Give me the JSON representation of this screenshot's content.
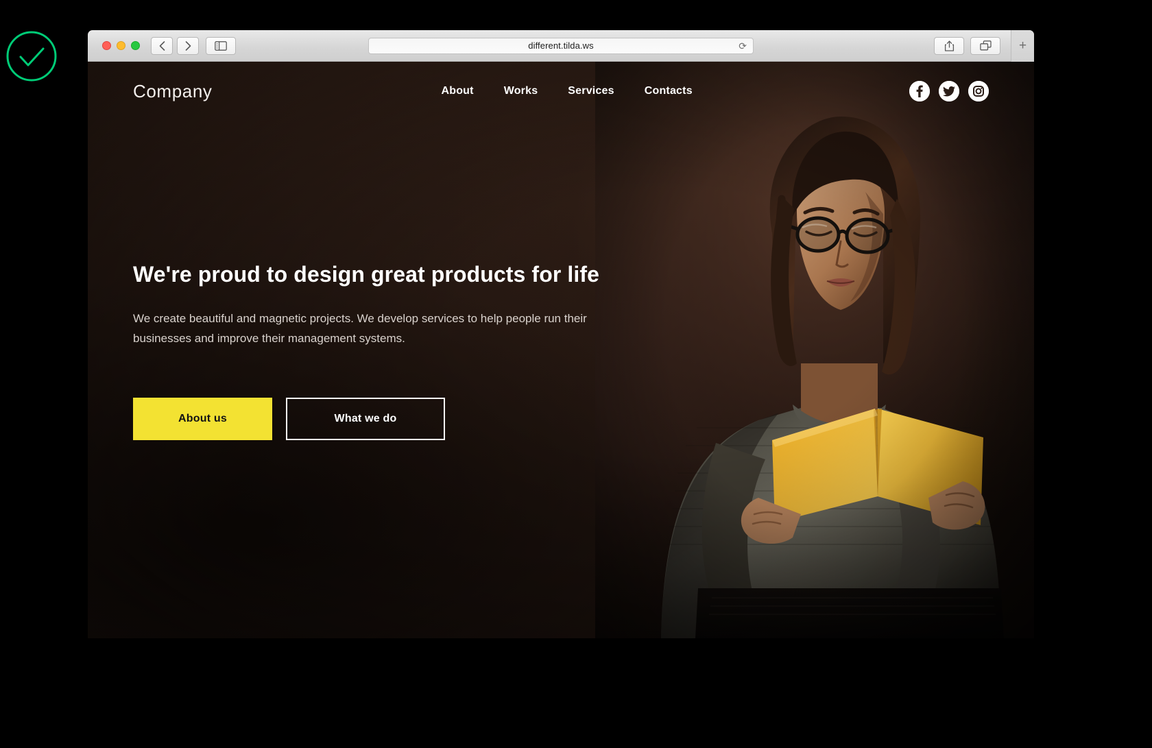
{
  "badge": {
    "name": "success-check",
    "color": "#00cc77"
  },
  "browser": {
    "url": "different.tilda.ws",
    "traffic_lights": [
      "close",
      "minimize",
      "maximize"
    ],
    "back_label": "‹",
    "forward_label": "›",
    "sidebar_icon": "sidebar-icon",
    "reload_label": "⟳",
    "share_icon": "share-icon",
    "tabs_icon": "tabs-overview-icon",
    "new_tab_label": "+"
  },
  "site": {
    "logo": "Company",
    "nav": [
      {
        "label": "About"
      },
      {
        "label": "Works"
      },
      {
        "label": "Services"
      },
      {
        "label": "Contacts"
      }
    ],
    "socials": [
      {
        "name": "facebook-icon",
        "label": "Facebook"
      },
      {
        "name": "twitter-icon",
        "label": "Twitter"
      },
      {
        "name": "instagram-icon",
        "label": "Instagram"
      }
    ],
    "hero": {
      "title": "We're proud to design great products for life",
      "subtitle": "We create beautiful and magnetic projects. We develop services to help people run their businesses and improve their management systems.",
      "primary_button": "About us",
      "secondary_button": "What we do",
      "accent_color": "#f3e232",
      "background_color": "#2a1c16"
    }
  }
}
